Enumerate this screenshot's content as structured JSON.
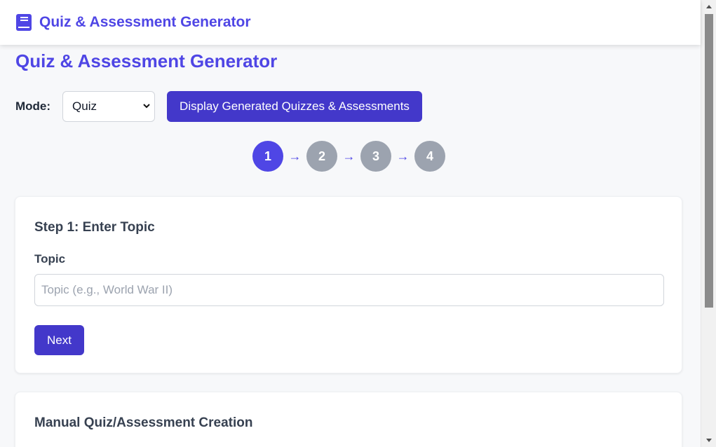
{
  "header": {
    "app_title": "Quiz & Assessment Generator",
    "icon": "book-icon"
  },
  "page": {
    "title": "Quiz & Assessment Generator"
  },
  "mode": {
    "label": "Mode:",
    "selected": "Quiz",
    "display_button": "Display Generated Quizzes & Assessments"
  },
  "steps": {
    "items": [
      "1",
      "2",
      "3",
      "4"
    ],
    "active": 1,
    "arrow": "→"
  },
  "step_card": {
    "title": "Step 1: Enter Topic",
    "field_label": "Topic",
    "placeholder": "Topic (e.g., World War II)",
    "value": "",
    "next_button": "Next"
  },
  "manual_card": {
    "title": "Manual Quiz/Assessment Creation"
  },
  "colors": {
    "accent": "#4f46e5",
    "button": "#4338ca",
    "inactive_step": "#9ca3af"
  }
}
